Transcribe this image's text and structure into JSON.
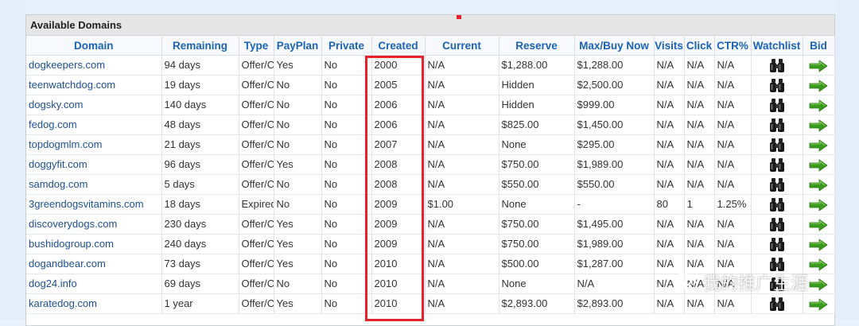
{
  "panel": {
    "title": "Available Domains"
  },
  "columns": [
    "Domain",
    "Remaining",
    "Type",
    "PayPlan",
    "Private",
    "Created",
    "Current",
    "Reserve",
    "Max/Buy Now",
    "Visits",
    "Click",
    "CTR%",
    "Watchlist",
    "Bid"
  ],
  "rows": [
    {
      "domain": "dogkeepers.com",
      "remaining": "94 days",
      "type": "Offer/C",
      "payplan": "Yes",
      "private": "No",
      "created": "2000",
      "current": "N/A",
      "reserve": "$1,288.00",
      "max": "$1,288.00",
      "visits": "N/A",
      "click": "N/A",
      "ctr": "N/A"
    },
    {
      "domain": "teenwatchdog.com",
      "remaining": "19 days",
      "type": "Offer/C",
      "payplan": "No",
      "private": "No",
      "created": "2005",
      "current": "N/A",
      "reserve": "Hidden",
      "max": "$2,500.00",
      "visits": "N/A",
      "click": "N/A",
      "ctr": "N/A"
    },
    {
      "domain": "dogsky.com",
      "remaining": "140 days",
      "type": "Offer/C",
      "payplan": "No",
      "private": "No",
      "created": "2006",
      "current": "N/A",
      "reserve": "Hidden",
      "max": "$999.00",
      "visits": "N/A",
      "click": "N/A",
      "ctr": "N/A"
    },
    {
      "domain": "fedog.com",
      "remaining": "48 days",
      "type": "Offer/C",
      "payplan": "No",
      "private": "No",
      "created": "2006",
      "current": "N/A",
      "reserve": "$825.00",
      "max": "$1,450.00",
      "visits": "N/A",
      "click": "N/A",
      "ctr": "N/A"
    },
    {
      "domain": "topdogmlm.com",
      "remaining": "21 days",
      "type": "Offer/C",
      "payplan": "No",
      "private": "No",
      "created": "2007",
      "current": "N/A",
      "reserve": "None",
      "max": "$295.00",
      "visits": "N/A",
      "click": "N/A",
      "ctr": "N/A"
    },
    {
      "domain": "doggyfit.com",
      "remaining": "96 days",
      "type": "Offer/C",
      "payplan": "Yes",
      "private": "No",
      "created": "2008",
      "current": "N/A",
      "reserve": "$750.00",
      "max": "$1,989.00",
      "visits": "N/A",
      "click": "N/A",
      "ctr": "N/A"
    },
    {
      "domain": "samdog.com",
      "remaining": "5 days",
      "type": "Offer/C",
      "payplan": "No",
      "private": "No",
      "created": "2008",
      "current": "N/A",
      "reserve": "$550.00",
      "max": "$550.00",
      "visits": "N/A",
      "click": "N/A",
      "ctr": "N/A"
    },
    {
      "domain": "3greendogsvitamins.com",
      "remaining": "18 days",
      "type": "Expired",
      "payplan": "No",
      "private": "No",
      "created": "2009",
      "current": "$1.00",
      "reserve": "None",
      "max": "-",
      "visits": "80",
      "click": "1",
      "ctr": "1.25%"
    },
    {
      "domain": "discoverydogs.com",
      "remaining": "230 days",
      "type": "Offer/C",
      "payplan": "Yes",
      "private": "No",
      "created": "2009",
      "current": "N/A",
      "reserve": "$750.00",
      "max": "$1,495.00",
      "visits": "N/A",
      "click": "N/A",
      "ctr": "N/A"
    },
    {
      "domain": "bushidogroup.com",
      "remaining": "240 days",
      "type": "Offer/C",
      "payplan": "Yes",
      "private": "No",
      "created": "2009",
      "current": "N/A",
      "reserve": "$750.00",
      "max": "$1,989.00",
      "visits": "N/A",
      "click": "N/A",
      "ctr": "N/A"
    },
    {
      "domain": "dogandbear.com",
      "remaining": "73 days",
      "type": "Offer/C",
      "payplan": "Yes",
      "private": "No",
      "created": "2010",
      "current": "N/A",
      "reserve": "$500.00",
      "max": "$1,287.00",
      "visits": "N/A",
      "click": "N/A",
      "ctr": "N/A"
    },
    {
      "domain": "dog24.info",
      "remaining": "69 days",
      "type": "Offer/C",
      "payplan": "No",
      "private": "No",
      "created": "2010",
      "current": "N/A",
      "reserve": "None",
      "max": "N/A",
      "visits": "N/A",
      "click": "N/A",
      "ctr": "N/A"
    },
    {
      "domain": "karatedog.com",
      "remaining": "1 year",
      "type": "Offer/C",
      "payplan": "Yes",
      "private": "No",
      "created": "2010",
      "current": "N/A",
      "reserve": "$2,893.00",
      "max": "$2,893.00",
      "visits": "N/A",
      "click": "N/A",
      "ctr": "N/A"
    }
  ],
  "row_icons": {
    "watchlist": "binoculars-icon",
    "bid": "green-arrow-right-icon"
  },
  "watermark": {
    "text": "我的推广生涯",
    "icon": "wechat-icon"
  },
  "colors": {
    "header_link": "#1b63b7",
    "domain_link": "#1f4f93",
    "highlight": "#e8212c",
    "arrow": "#3a9a1e"
  }
}
